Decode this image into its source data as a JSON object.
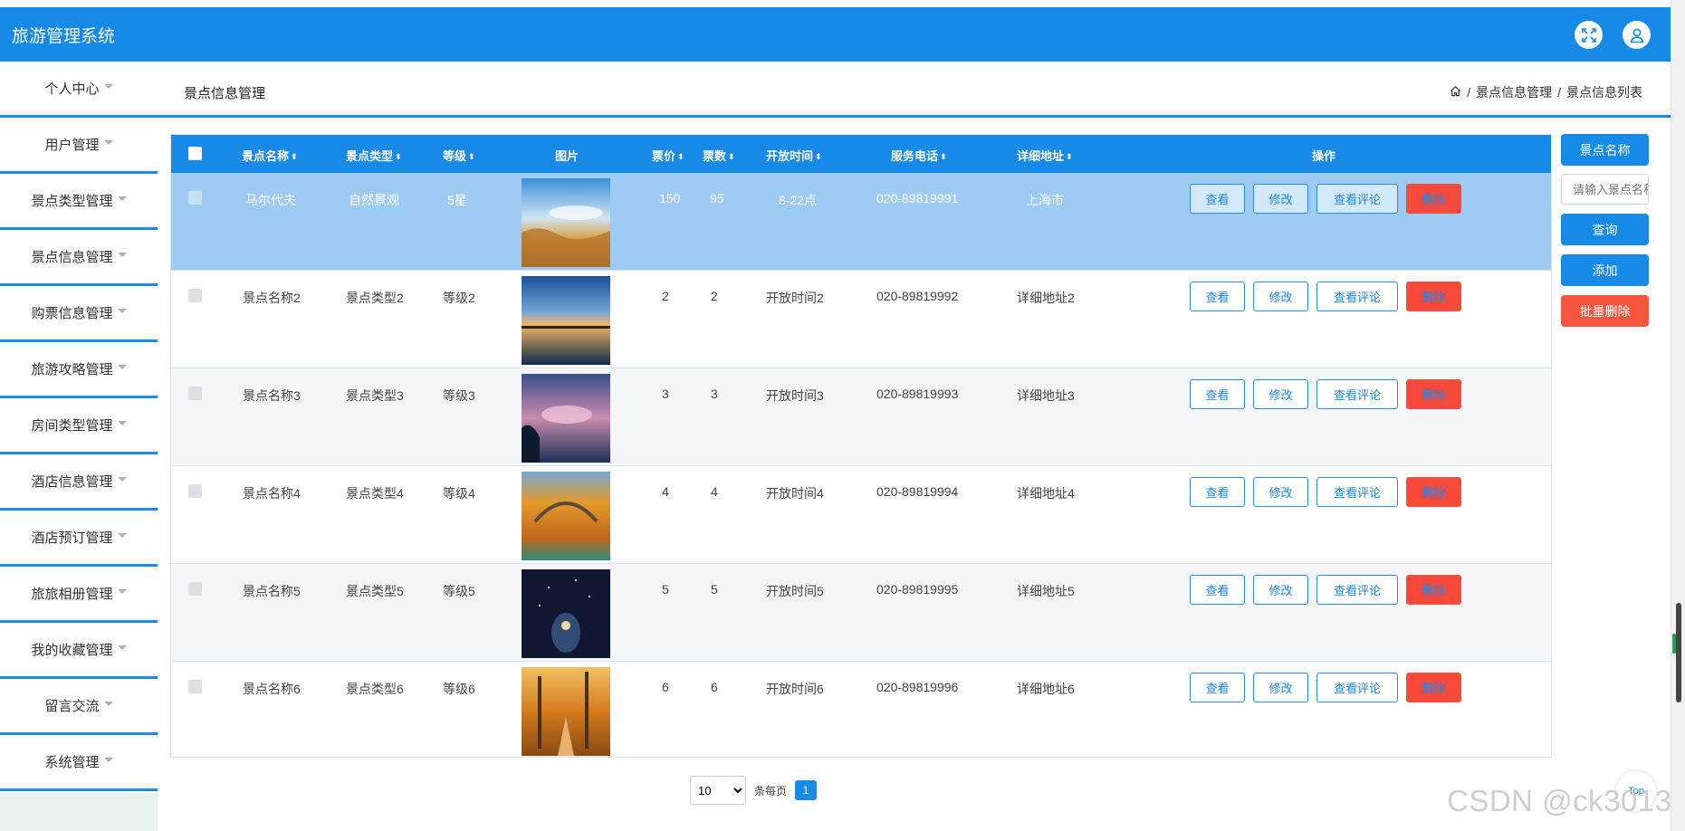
{
  "app": {
    "title": "旅游管理系统",
    "icons": [
      "fullscreen-icon",
      "user-icon"
    ]
  },
  "sidebar": {
    "items": [
      {
        "label": "个人中心"
      },
      {
        "label": "用户管理"
      },
      {
        "label": "景点类型管理"
      },
      {
        "label": "景点信息管理"
      },
      {
        "label": "购票信息管理"
      },
      {
        "label": "旅游攻略管理"
      },
      {
        "label": "房间类型管理"
      },
      {
        "label": "酒店信息管理"
      },
      {
        "label": "酒店预订管理"
      },
      {
        "label": "旅旅相册管理"
      },
      {
        "label": "我的收藏管理"
      },
      {
        "label": "留言交流"
      },
      {
        "label": "系统管理"
      }
    ]
  },
  "content": {
    "title": "景点信息管理",
    "breadcrumb": [
      "景点信息管理",
      "景点信息列表"
    ],
    "breadcrumb_sep": "/"
  },
  "table": {
    "columns": [
      "景点名称",
      "景点类型",
      "等级",
      "图片",
      "票价",
      "票数",
      "开放时间",
      "服务电话",
      "详细地址",
      "操作"
    ],
    "actions": {
      "view": "查看",
      "edit": "修改",
      "comment": "查看评论",
      "delete": "删除"
    },
    "rows": [
      {
        "name": "马尔代夫",
        "type": "自然景观",
        "level": "5星",
        "price": "150",
        "tickets": "95",
        "hours": "8-22点",
        "phone": "020-89819991",
        "address": "上海市",
        "selected": true
      },
      {
        "name": "景点名称2",
        "type": "景点类型2",
        "level": "等级2",
        "price": "2",
        "tickets": "2",
        "hours": "开放时间2",
        "phone": "020-89819992",
        "address": "详细地址2",
        "selected": false
      },
      {
        "name": "景点名称3",
        "type": "景点类型3",
        "level": "等级3",
        "price": "3",
        "tickets": "3",
        "hours": "开放时间3",
        "phone": "020-89819993",
        "address": "详细地址3",
        "selected": false
      },
      {
        "name": "景点名称4",
        "type": "景点类型4",
        "level": "等级4",
        "price": "4",
        "tickets": "4",
        "hours": "开放时间4",
        "phone": "020-89819994",
        "address": "详细地址4",
        "selected": false
      },
      {
        "name": "景点名称5",
        "type": "景点类型5",
        "level": "等级5",
        "price": "5",
        "tickets": "5",
        "hours": "开放时间5",
        "phone": "020-89819995",
        "address": "详细地址5",
        "selected": false
      },
      {
        "name": "景点名称6",
        "type": "景点类型6",
        "level": "等级6",
        "price": "6",
        "tickets": "6",
        "hours": "开放时间6",
        "phone": "020-89819996",
        "address": "详细地址6",
        "selected": false
      }
    ]
  },
  "search": {
    "label": "景点名称",
    "placeholder": "请输入景点名称",
    "query_btn": "查询",
    "add_btn": "添加",
    "batch_delete_btn": "批量删除"
  },
  "pagination": {
    "page_size": "10",
    "page_size_label": "条每页",
    "current_page": "1"
  },
  "top_button": "Top",
  "watermark": "CSDN @ck3013",
  "colors": {
    "primary": "#1789e6",
    "danger": "#f84a3a",
    "selected_row": "#9ecbf3"
  }
}
